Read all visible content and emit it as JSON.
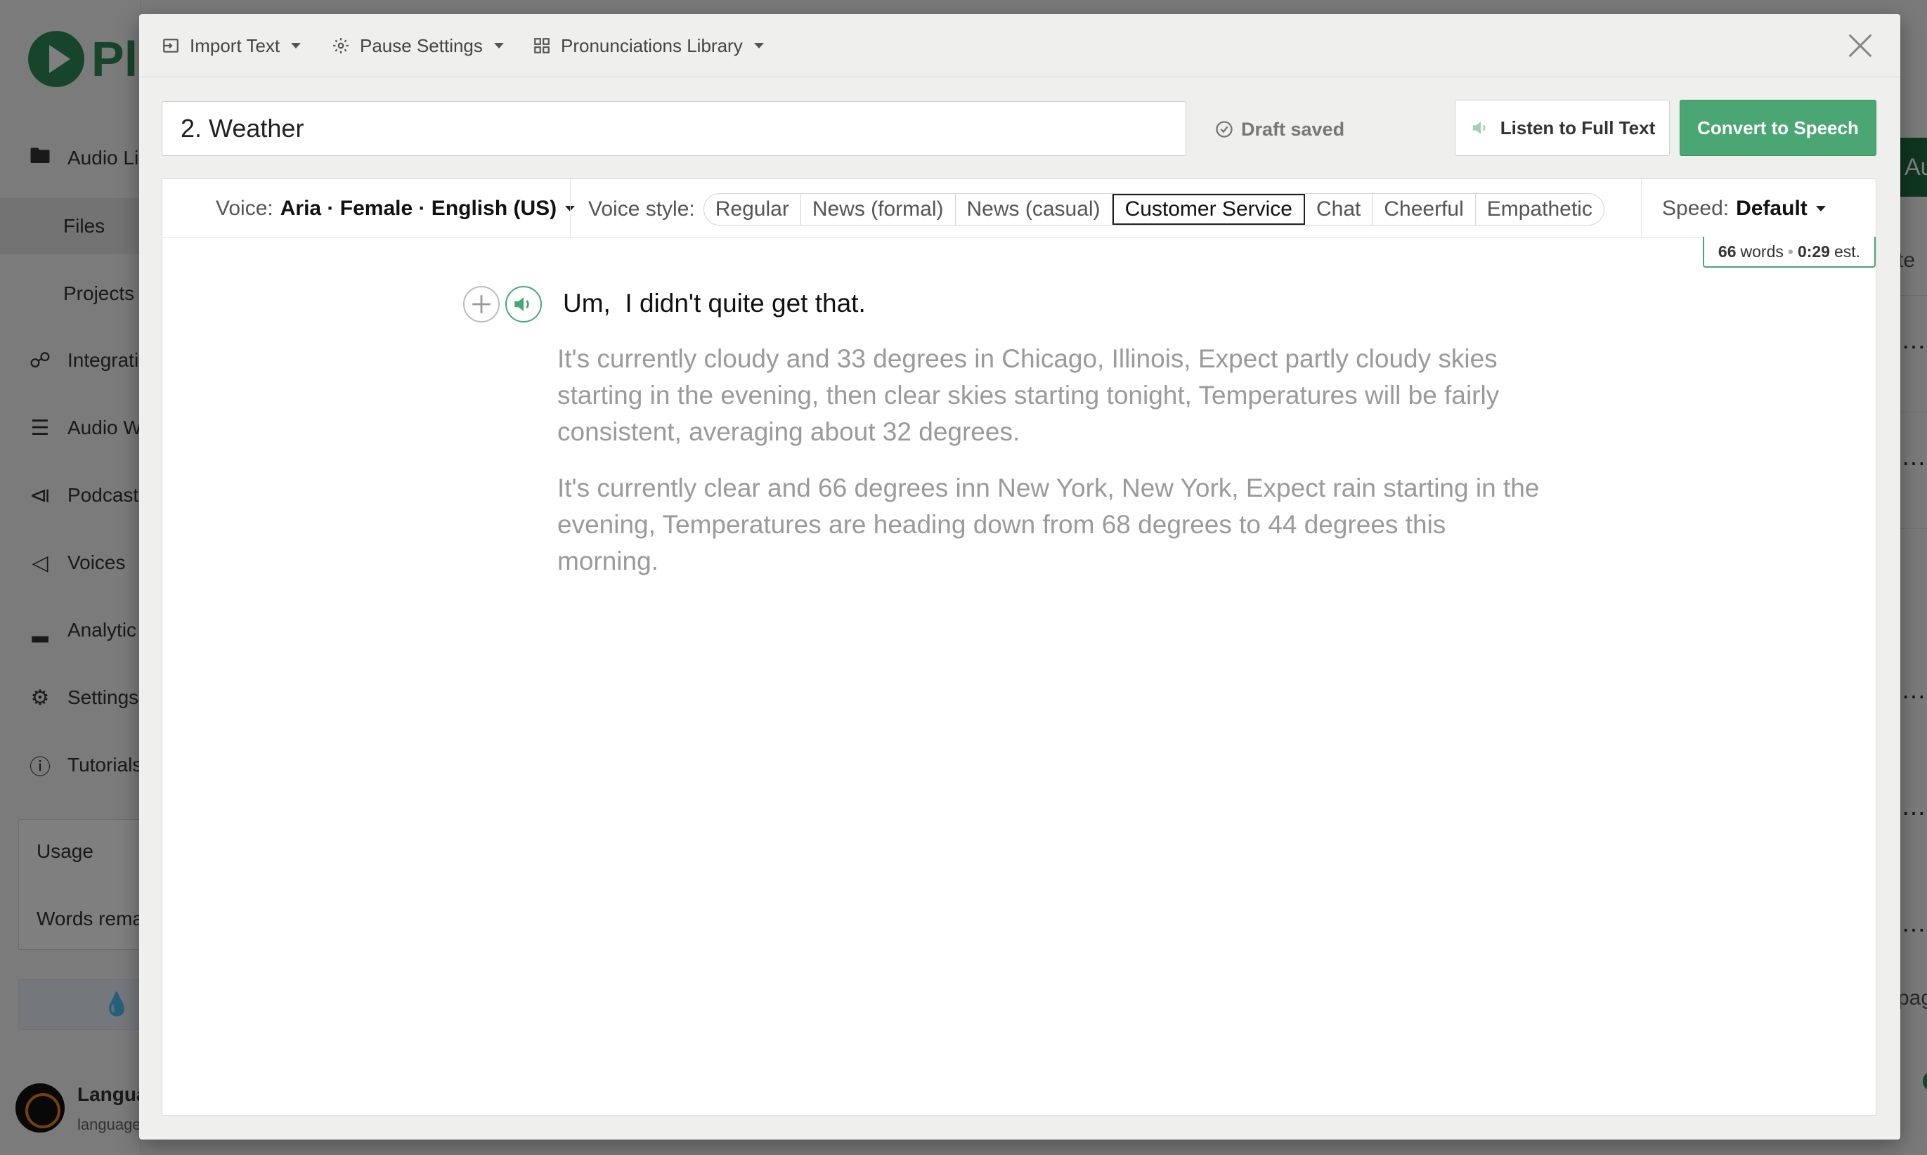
{
  "background": {
    "logo_text": "Pl",
    "nav": [
      {
        "label": "Audio Li",
        "icon": "folder-icon"
      },
      {
        "label": "Files",
        "icon": ""
      },
      {
        "label": "Projects",
        "icon": ""
      },
      {
        "label": "Integrati",
        "icon": "plug-icon"
      },
      {
        "label": "Audio W",
        "icon": "list-icon"
      },
      {
        "label": "Podcast",
        "icon": "rss-icon"
      },
      {
        "label": "Voices",
        "icon": "megaphone-icon"
      },
      {
        "label": "Analytic",
        "icon": "chart-icon"
      },
      {
        "label": "Settings",
        "icon": "gear-icon"
      },
      {
        "label": "Tutorials",
        "icon": "info-icon"
      }
    ],
    "usage_title": "Usage",
    "usage_words": "Words rema",
    "user_name": "Langua",
    "user_email": "language",
    "right_button": "Au",
    "right_frag_1": "te",
    "right_frag_2": "pag"
  },
  "toolbar": {
    "import_label": "Import Text",
    "pause_label": "Pause Settings",
    "pronunciations_label": "Pronunciations Library"
  },
  "header": {
    "title_value": "2. Weather",
    "draft_status": "Draft saved",
    "listen_label": "Listen to Full Text",
    "convert_label": "Convert to Speech"
  },
  "settings": {
    "voice_label": "Voice:",
    "voice_value": "Aria · Female · English (US)",
    "style_label": "Voice style:",
    "styles": [
      "Regular",
      "News (formal)",
      "News (casual)",
      "Customer Service",
      "Chat",
      "Cheerful",
      "Empathetic"
    ],
    "selected_style": "Customer Service",
    "speed_label": "Speed:",
    "speed_value": "Default"
  },
  "stats": {
    "word_count": "66",
    "words_label": "words",
    "duration": "0:29",
    "duration_suffix": "est."
  },
  "content": {
    "active_line": "Um,  I didn't quite get that.",
    "paragraphs": [
      "It's currently cloudy and 33 degrees in Chicago, Illinois, Expect partly cloudy skies starting in the evening, then clear skies starting tonight, Temperatures will be fairly consistent, averaging about 32 degrees.",
      "It's currently clear and 66 degrees inn New York, New York, Expect rain starting in the evening, Temperatures are heading down from 68 degrees to 44 degrees this morning."
    ]
  },
  "colors": {
    "accent_green": "#4aa673",
    "brand_green": "#2e8b57"
  }
}
